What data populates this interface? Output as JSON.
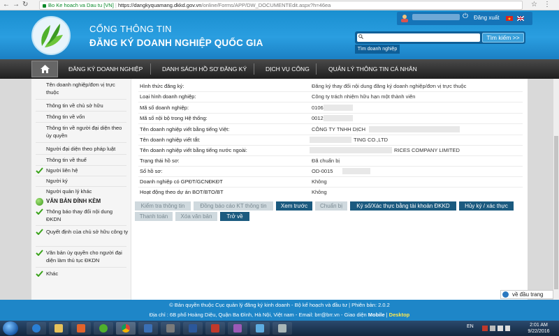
{
  "browser": {
    "secure_label": "Bo Ke hoach va Dau tu [VN]",
    "url_domain": "https://dangkyquamang.dkkd.gov.vn",
    "url_path": "/online/Forms/APP/DW_DOCUMENTEdit.aspx?h=46ea"
  },
  "header": {
    "title_line1": "CỔNG THÔNG TIN",
    "title_line2": "ĐĂNG KÝ DOANH NGHIỆP QUỐC GIA",
    "logout_label": "Đăng xuất",
    "search_placeholder": "",
    "search_button": "Tìm kiếm >>",
    "search_hint": "Tìm doanh nghiệp"
  },
  "nav": {
    "items": [
      {
        "label": "ĐĂNG KÝ DOANH NGHIỆP"
      },
      {
        "label": "DANH SÁCH HỒ SƠ ĐĂNG KÝ"
      },
      {
        "label": "DỊCH VỤ CÔNG"
      },
      {
        "label": "QUẢN LÝ THÔNG TIN CÁ NHÂN"
      }
    ]
  },
  "sidebar": {
    "items": [
      {
        "label": "Tên doanh nghiệp/đơn vị trực thuộc",
        "checked": false
      },
      {
        "label": "Thông tin về chủ sở hữu",
        "checked": false
      },
      {
        "label": "Thông tin về vốn",
        "checked": false
      },
      {
        "label": "Thông tin về người đại diện theo ủy quyền",
        "checked": false
      },
      {
        "label": "Người đại diện theo pháp luật",
        "checked": false
      },
      {
        "label": "Thông tin về thuế",
        "checked": false
      },
      {
        "label": "Người liên hệ",
        "checked": true
      },
      {
        "label": "Người ký",
        "checked": false
      },
      {
        "label": "Người quản lý khác",
        "checked": false
      }
    ],
    "attach_heading": "VĂN BẢN ĐÍNH KÈM",
    "attachments": [
      {
        "label": "Thông báo thay đổi nội dung ĐKDN",
        "checked": true
      },
      {
        "label": "Quyết định của chủ sở hữu công ty",
        "checked": true
      },
      {
        "label": "Văn bản ủy quyền cho người đại diện làm thủ tục ĐKDN",
        "checked": true
      },
      {
        "label": "Khác",
        "checked": true
      }
    ]
  },
  "details": [
    {
      "label": "Hình thức đăng ký:",
      "value": "Đăng ký thay đổi nội dung đăng ký doanh nghiệp/đơn vị trực thuộc"
    },
    {
      "label": "Loại hình doanh nghiệp:",
      "value": "Công ty trách nhiệm hữu hạn một thành viên"
    },
    {
      "label": "Mã số doanh nghiệp:",
      "value": "0106"
    },
    {
      "label": "Mã số nội bộ trong Hệ thống:",
      "value": "0012"
    },
    {
      "label": "Tên doanh nghiệp viết bằng tiếng Việt:",
      "value": "CÔNG TY TNHH DỊCH"
    },
    {
      "label": "Tên doanh nghiệp viết tắt:",
      "value": "TING CO.,LTD"
    },
    {
      "label": "Tên doanh nghiệp viết bằng tiếng nước ngoài:",
      "value": "RICES COMPANY LIMITED"
    },
    {
      "label": "Trạng thái hồ sơ:",
      "value": "Đã chuẩn bị"
    },
    {
      "label": "Số hồ sơ:",
      "value": "OD-0015"
    },
    {
      "label": "Doanh nghiệp có GPĐT/GCNĐKĐT",
      "value": "Không"
    },
    {
      "label": "Hoạt động theo dự án BOT/BTO/BT",
      "value": "Không"
    }
  ],
  "actions": {
    "kiem_tra": "Kiểm tra thông tin",
    "dong_bao_cao": "Đồng báo cáo KT thông tin",
    "xem_truoc": "Xem trước",
    "chuan_bi": "Chuẩn bị",
    "ky_so": "Ký số/Xác thực bằng tài khoản ĐKKD",
    "huy_ky": "Hủy ký / xác thực",
    "thanh_toan": "Thanh toán",
    "xoa_van_ban": "Xóa văn bản",
    "tro_ve": "Trở về"
  },
  "back_to_top": "về đầu trang",
  "footer": {
    "line1": "© Bản quyền thuộc Cục quản lý đăng ký kinh doanh - Bộ kế hoạch và đầu tư | Phiên bản: 2.0.2",
    "line2_prefix": "Địa chỉ : 6B phố Hoàng Diệu, Quận Ba Đình, Hà Nội, Việt nam - Email: brr@brr.vn - Giao diện",
    "mobile": "Mobile",
    "sep": "|",
    "desktop": "Desktop"
  },
  "taskbar": {
    "lang": "EN",
    "time": "2:01 AM",
    "date": "9/22/2016"
  },
  "colors": {
    "header_blue": "#1a8fd0",
    "nav_dark": "#2a2a2a",
    "footer_blue": "#1e86c8",
    "button_active": "#1b5a7f",
    "button_disabled": "#cfd9de",
    "check_green": "#3aa31a"
  }
}
